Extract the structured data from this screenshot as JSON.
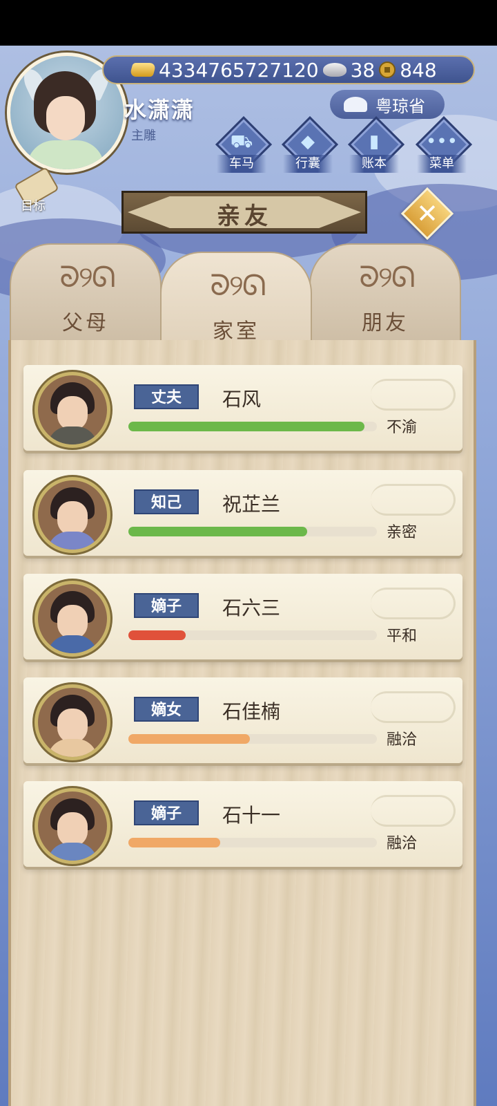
{
  "player": {
    "name": "水潇潇",
    "title": "主雕",
    "region": "粤琼省"
  },
  "currency": {
    "gold": "4334765727120",
    "silver": "38",
    "coins": "848"
  },
  "top_menu": [
    {
      "label": "车马",
      "icon": "carriage-icon"
    },
    {
      "label": "行囊",
      "icon": "bag-icon"
    },
    {
      "label": "账本",
      "icon": "ledger-icon"
    },
    {
      "label": "菜单",
      "icon": "menu-dots-icon"
    }
  ],
  "goal_label": "目标",
  "header_title": "亲友",
  "tabs": [
    {
      "label": "父母",
      "active": false
    },
    {
      "label": "家室",
      "active": true
    },
    {
      "label": "朋友",
      "active": false
    }
  ],
  "members": [
    {
      "relation": "丈夫",
      "name": "石风",
      "status": "不渝",
      "level": 0.95,
      "bar_color": "#6cb84a",
      "robe": "#5a5a52"
    },
    {
      "relation": "知己",
      "name": "祝芷兰",
      "status": "亲密",
      "level": 0.72,
      "bar_color": "#6cb84a",
      "robe": "#7a86c8"
    },
    {
      "relation": "嫡子",
      "name": "石六三",
      "status": "平和",
      "level": 0.23,
      "bar_color": "#e0513a",
      "robe": "#4a6aa8"
    },
    {
      "relation": "嫡女",
      "name": "石佳楠",
      "status": "融洽",
      "level": 0.49,
      "bar_color": "#f0a866",
      "robe": "#e8c8a0"
    },
    {
      "relation": "嫡子",
      "name": "石十一",
      "status": "融洽",
      "level": 0.37,
      "bar_color": "#f0a866",
      "robe": "#6a86c0"
    }
  ]
}
